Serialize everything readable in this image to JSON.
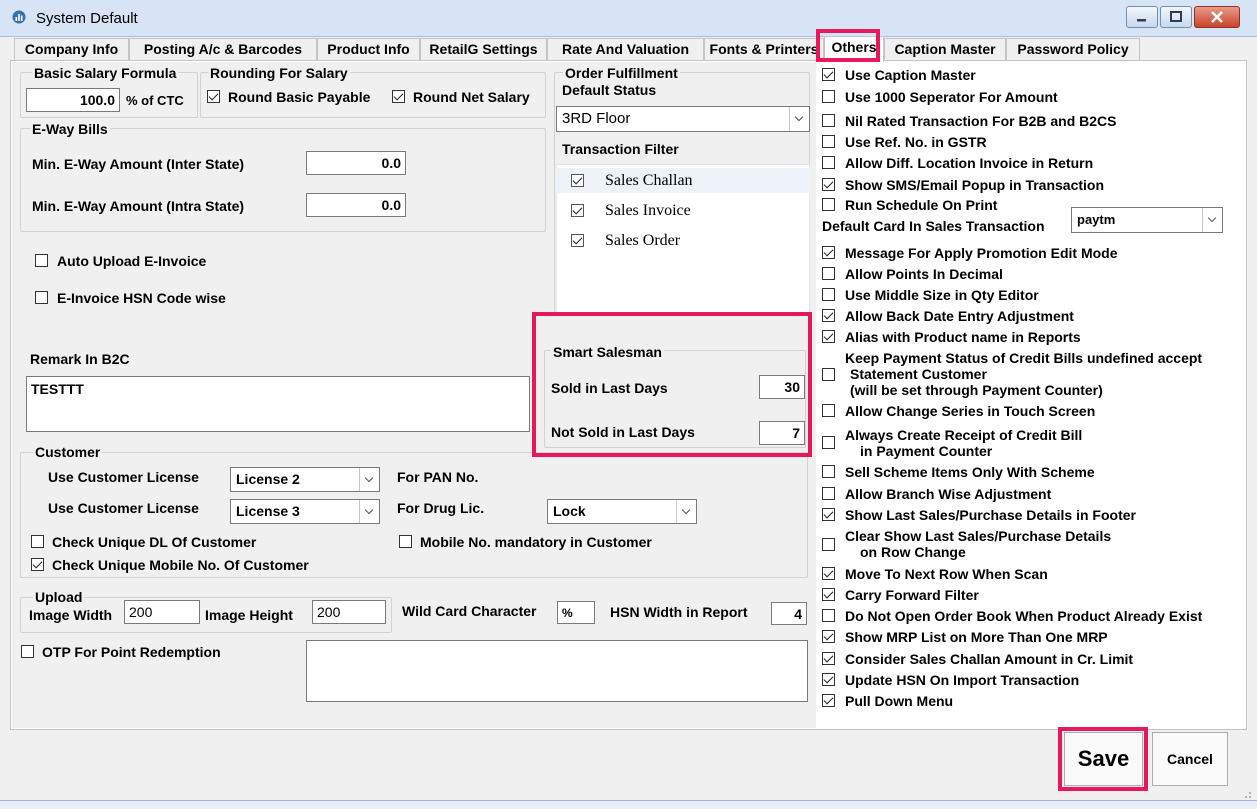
{
  "window": {
    "title": "System Default"
  },
  "tabs": [
    "Company Info",
    "Posting A/c & Barcodes",
    "Product Info",
    "RetailG Settings",
    "Rate And Valuation",
    "Fonts & Printers",
    "Others",
    "Caption Master",
    "Password Policy"
  ],
  "salary": {
    "basic_formula_label": "Basic Salary Formula",
    "basic_value": "100.0",
    "ctc_suffix": "% of CTC",
    "rounding_label": "Rounding For Salary",
    "round_basic": "Round Basic Payable",
    "round_net": "Round Net Salary"
  },
  "eway": {
    "label": "E-Way Bills",
    "inter_label": "Min. E-Way Amount (Inter State)",
    "inter_value": "0.0",
    "intra_label": "Min. E-Way Amount (Intra State)",
    "intra_value": "0.0"
  },
  "auto_upload": "Auto Upload E-Invoice",
  "hsn_code_wise": "E-Invoice HSN Code wise",
  "order": {
    "label": "Order Fulfillment",
    "default_status_label": "Default Status",
    "default_status_value": "3RD Floor",
    "transaction_filter_label": "Transaction Filter",
    "filters": [
      "Sales Challan",
      "Sales Invoice",
      "Sales Order"
    ]
  },
  "smart": {
    "label": "Smart Salesman",
    "sold_label": "Sold in Last Days",
    "sold_value": "30",
    "not_sold_label": "Not Sold in Last Days",
    "not_sold_value": "7"
  },
  "remark": {
    "label": "Remark In B2C",
    "value": "TESTTT"
  },
  "customer": {
    "label": "Customer",
    "license_label": "Use Customer License",
    "license1": "License 2",
    "license2": "License 3",
    "pan_label": "For PAN No.",
    "drug_label": "For Drug Lic.",
    "drug_value": "Lock",
    "unique_dl": "Check Unique DL Of Customer",
    "unique_mobile": "Check Unique Mobile No. Of Customer",
    "mobile_mandatory": "Mobile No. mandatory in Customer"
  },
  "upload": {
    "label": "Upload",
    "width_label": "Image Width",
    "width_value": "200",
    "height_label": "Image Height",
    "height_value": "200"
  },
  "wildcard": {
    "label": "Wild Card Character",
    "value": "%"
  },
  "hsn_width": {
    "label": "HSN Width in Report",
    "value": "4"
  },
  "otp": "OTP For Point Redemption",
  "right": {
    "use_caption_master": "Use Caption Master",
    "use_1000_sep": "Use 1000 Seperator For Amount",
    "nil_rated": "Nil Rated Transaction For B2B and B2CS",
    "use_ref_no": "Use Ref. No. in GSTR",
    "allow_diff_location": "Allow Diff. Location Invoice in Return",
    "show_sms": "Show SMS/Email Popup in Transaction",
    "run_schedule": "Run Schedule On Print",
    "default_card_label": "Default Card In Sales Transaction",
    "default_card_value": "paytm",
    "message_promotion": "Message For Apply Promotion Edit Mode",
    "allow_points_decimal": "Allow Points In Decimal",
    "use_middle_size": "Use Middle Size in Qty Editor",
    "allow_back_date": "Allow Back Date Entry Adjustment",
    "alias_product": "Alias with Product name in Reports",
    "keep_payment_1": "Keep Payment Status of Credit Bills undefined accept",
    "keep_payment_2": "Statement Customer",
    "keep_payment_3": "(will be set through Payment Counter)",
    "allow_change_series": "Allow Change Series in Touch Screen",
    "always_create_1": "Always Create Receipt of Credit Bill",
    "always_create_2": "in Payment Counter",
    "sell_scheme": "Sell Scheme Items Only With Scheme",
    "allow_branch": "Allow Branch Wise Adjustment",
    "show_last_sales": "Show Last Sales/Purchase Details in Footer",
    "clear_show_1": "Clear Show Last Sales/Purchase Details",
    "clear_show_2": "on Row Change",
    "move_next_row": "Move To Next Row When Scan",
    "carry_forward": "Carry Forward Filter",
    "do_not_open": "Do Not Open Order Book When Product Already Exist",
    "show_mrp": "Show MRP List on More Than One MRP",
    "consider_challan": "Consider Sales Challan Amount in Cr. Limit",
    "update_hsn": "Update HSN On Import Transaction",
    "pull_down": "Pull Down Menu"
  },
  "buttons": {
    "save": "Save",
    "cancel": "Cancel"
  },
  "colors": {
    "highlight": "#e8195a"
  }
}
